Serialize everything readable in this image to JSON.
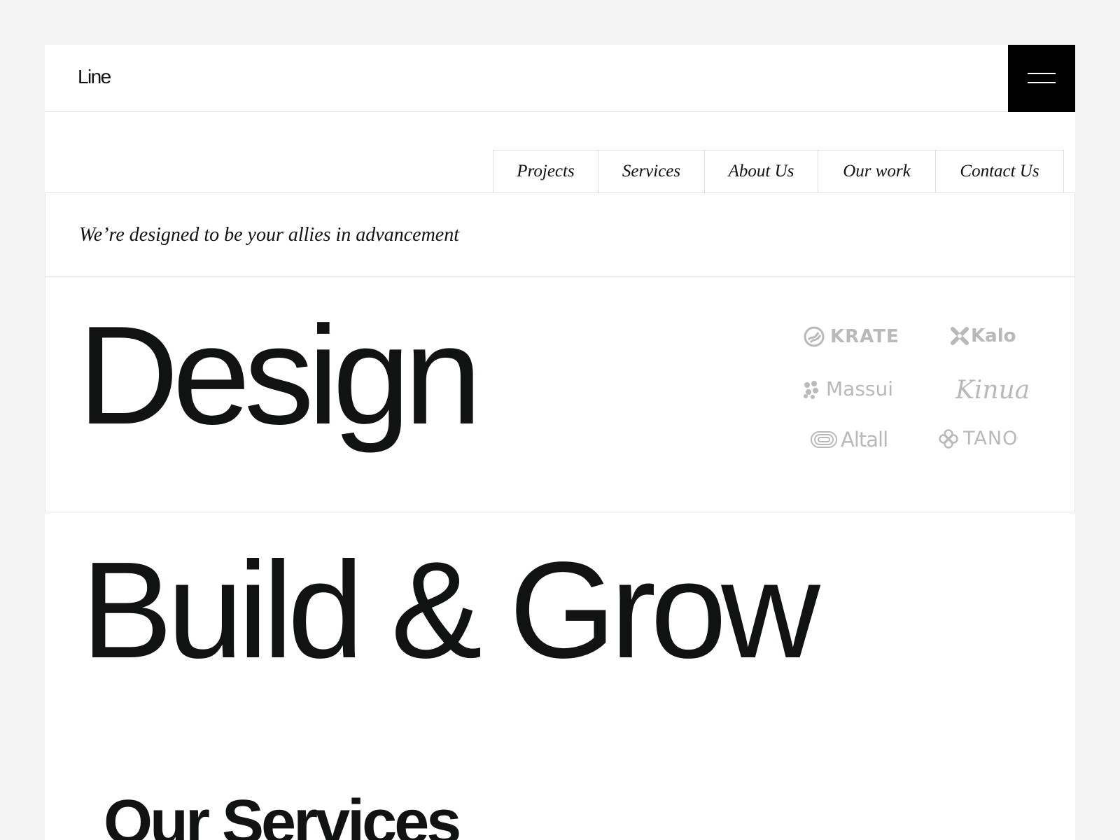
{
  "header": {
    "logo": "Line",
    "menu_icon": "hamburger-menu-icon"
  },
  "nav": {
    "items": [
      {
        "label": "Projects"
      },
      {
        "label": "Services"
      },
      {
        "label": "About Us"
      },
      {
        "label": "Our work"
      },
      {
        "label": "Contact Us"
      }
    ]
  },
  "hero": {
    "tagline": "We’re designed to be your allies in advancement",
    "heading_primary": "Design",
    "heading_secondary": "Build & Grow"
  },
  "partners": {
    "logos": [
      {
        "name": "KRATE",
        "icon": "krate-logo-icon"
      },
      {
        "name": "Kalo",
        "icon": "kalo-logo-icon"
      },
      {
        "name": "Massui",
        "icon": "massui-logo-icon"
      },
      {
        "name": "Kinua",
        "icon": ""
      },
      {
        "name": "Altall",
        "icon": "altall-logo-icon"
      },
      {
        "name": "TANO",
        "icon": "tano-logo-icon"
      }
    ],
    "color": "#b9b9b9"
  },
  "services": {
    "title": "Our Services"
  },
  "colors": {
    "background": "#f4f4f4",
    "surface": "#ffffff",
    "text": "#101312",
    "menu_button": "#000000",
    "border": "#e1e1e1"
  }
}
